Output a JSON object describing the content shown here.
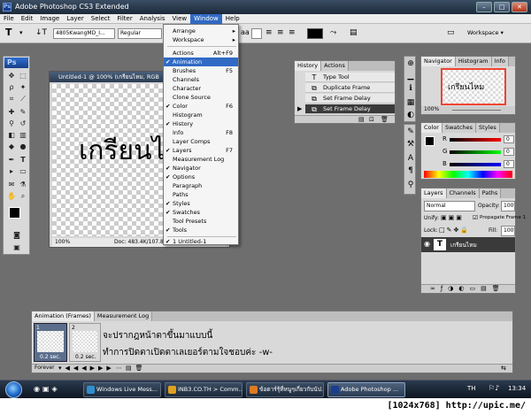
{
  "window": {
    "title": "Adobe Photoshop CS3 Extended",
    "minimize": "–",
    "maximize": "□",
    "close": "✕"
  },
  "menubar": [
    "File",
    "Edit",
    "Image",
    "Layer",
    "Select",
    "Filter",
    "Analysis",
    "View",
    "Window",
    "Help"
  ],
  "options_bar": {
    "font_family": "4805KwangMD_I...",
    "font_style": "Regular",
    "workspace_label": "Workspace ▾"
  },
  "window_menu": {
    "items": [
      {
        "label": "Arrange",
        "arrow": "▸"
      },
      {
        "label": "Workspace",
        "arrow": "▸"
      },
      {
        "label": "Actions",
        "shortcut": "Alt+F9"
      },
      {
        "label": "Animation",
        "checked": "✔"
      },
      {
        "label": "Brushes",
        "shortcut": "F5"
      },
      {
        "label": "Channels"
      },
      {
        "label": "Character"
      },
      {
        "label": "Clone Source"
      },
      {
        "label": "Color",
        "checked": "✔",
        "shortcut": "F6"
      },
      {
        "label": "Histogram"
      },
      {
        "label": "History",
        "checked": "✔"
      },
      {
        "label": "Info",
        "shortcut": "F8"
      },
      {
        "label": "Layer Comps"
      },
      {
        "label": "Layers",
        "checked": "✔",
        "shortcut": "F7"
      },
      {
        "label": "Measurement Log"
      },
      {
        "label": "Navigator",
        "checked": "✔"
      },
      {
        "label": "Options",
        "checked": "✔"
      },
      {
        "label": "Paragraph"
      },
      {
        "label": "Paths"
      },
      {
        "label": "Styles",
        "checked": "✔"
      },
      {
        "label": "Swatches",
        "checked": "✔"
      },
      {
        "label": "Tool Presets"
      },
      {
        "label": "Tools",
        "checked": "✔"
      },
      {
        "label": "1 Untitled-1",
        "checked": "✔"
      }
    ]
  },
  "document": {
    "title": "Untitled-1 @ 100% (เกรียนไหม, RGB",
    "canvas_text": "เกรียนไ",
    "zoom": "100%",
    "doc_info": "Doc: 483.4K/107.8K"
  },
  "history_panel": {
    "tabs": [
      "History",
      "Actions"
    ],
    "rows": [
      {
        "label": "Type Tool",
        "icon": "T"
      },
      {
        "label": "Duplicate Frame",
        "icon": "⧉"
      },
      {
        "label": "Set Frame Delay",
        "icon": "⧉"
      },
      {
        "label": "Set Frame Delay",
        "icon": "⧉",
        "selected": true
      }
    ]
  },
  "navigator_panel": {
    "tabs": [
      "Navigator",
      "Histogram",
      "Info"
    ],
    "preview_text": "เกรียนไหม",
    "zoom": "100%"
  },
  "color_panel": {
    "tabs": [
      "Color",
      "Swatches",
      "Styles"
    ],
    "channels": [
      {
        "label": "R",
        "value": "0"
      },
      {
        "label": "G",
        "value": "0"
      },
      {
        "label": "B",
        "value": "0"
      }
    ]
  },
  "layers_panel": {
    "tabs": [
      "Layers",
      "Channels",
      "Paths"
    ],
    "blend_mode": "Normal",
    "opacity_label": "Opacity:",
    "opacity": "100%",
    "unify_label": "Unify:",
    "propagate_label": "Propagate Frame 1",
    "lock_label": "Lock:",
    "fill_label": "Fill:",
    "fill": "100%",
    "layer_name": "เกรียนไหม",
    "layer_icon": "T"
  },
  "animation_panel": {
    "tabs": [
      "Animation (Frames)",
      "Measurement Log"
    ],
    "frames": [
      {
        "number": "1",
        "delay": "0.2 sec."
      },
      {
        "number": "2",
        "delay": "0.2 sec."
      }
    ],
    "loop": "Forever",
    "overlay_line1": "จะปรากฎหน้าตาขึ้นมาแบบนี้",
    "overlay_line2": "ทำการปิดตาเปิดตาเลเยอร์ตามใจชอบค่ะ -w-"
  },
  "taskbar": {
    "buttons": [
      {
        "label": "Windows Live Mess...",
        "color": "#2f8fd0"
      },
      {
        "label": "INB3.CO.TH > Comm...",
        "color": "#e0a020"
      },
      {
        "label": "ข้อดาร์รุ้ที่หนูๆเกี่ยวกับนัป...",
        "color": "#e07a20"
      },
      {
        "label": "Adobe Photoshop ...",
        "color": "#1a3d8f",
        "active": true
      }
    ],
    "lang": "TH",
    "time": "13:34"
  },
  "footer": {
    "text": "[1024x768] http://upic.me/"
  },
  "colors": {
    "highlight": "#316ac5",
    "taskbar": "#1d2b3c",
    "photoshop_blue": "#1a3d8f"
  }
}
